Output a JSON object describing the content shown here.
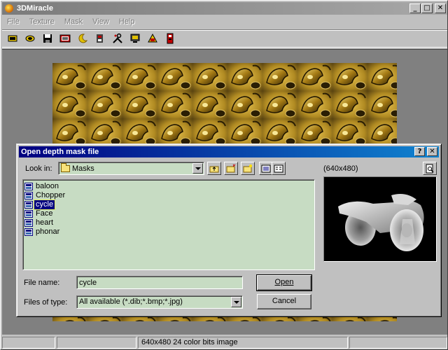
{
  "app": {
    "title": "3DMiracle",
    "menu": [
      "File",
      "Texture",
      "Mask",
      "View",
      "Help"
    ],
    "caption_buttons": {
      "minimize": "_",
      "maximize": "□",
      "close": "✕"
    }
  },
  "toolbar": {
    "tools": [
      "open-icon",
      "save-icon",
      "disk-icon",
      "stereo-icon",
      "moon-icon",
      "mask-icon",
      "tools-icon",
      "monitor-icon",
      "print-icon",
      "exit-icon"
    ]
  },
  "status": {
    "cells": [
      "",
      "",
      "640x480 24 color bits image",
      ""
    ]
  },
  "dialog": {
    "title": "Open depth mask file",
    "help_btn": "?",
    "close_btn": "✕",
    "look_in_label": "Look in:",
    "look_in_value": "Masks",
    "preview_size": "(640x480)",
    "files": [
      {
        "name": "baloon",
        "selected": false
      },
      {
        "name": "Chopper",
        "selected": false
      },
      {
        "name": "cycle",
        "selected": true
      },
      {
        "name": "Face",
        "selected": false
      },
      {
        "name": "heart",
        "selected": false
      },
      {
        "name": "phonar",
        "selected": false
      }
    ],
    "file_name_label": "File name:",
    "file_name_value": "cycle",
    "file_type_label": "Files of type:",
    "file_type_value": "All available (*.dib;*.bmp;*.jpg)",
    "open_label": "Open",
    "cancel_label": "Cancel"
  },
  "colors": {
    "list_bg": "#c7dcc3",
    "dialog_title": "#000080",
    "texture_gold": "#c8a030"
  }
}
